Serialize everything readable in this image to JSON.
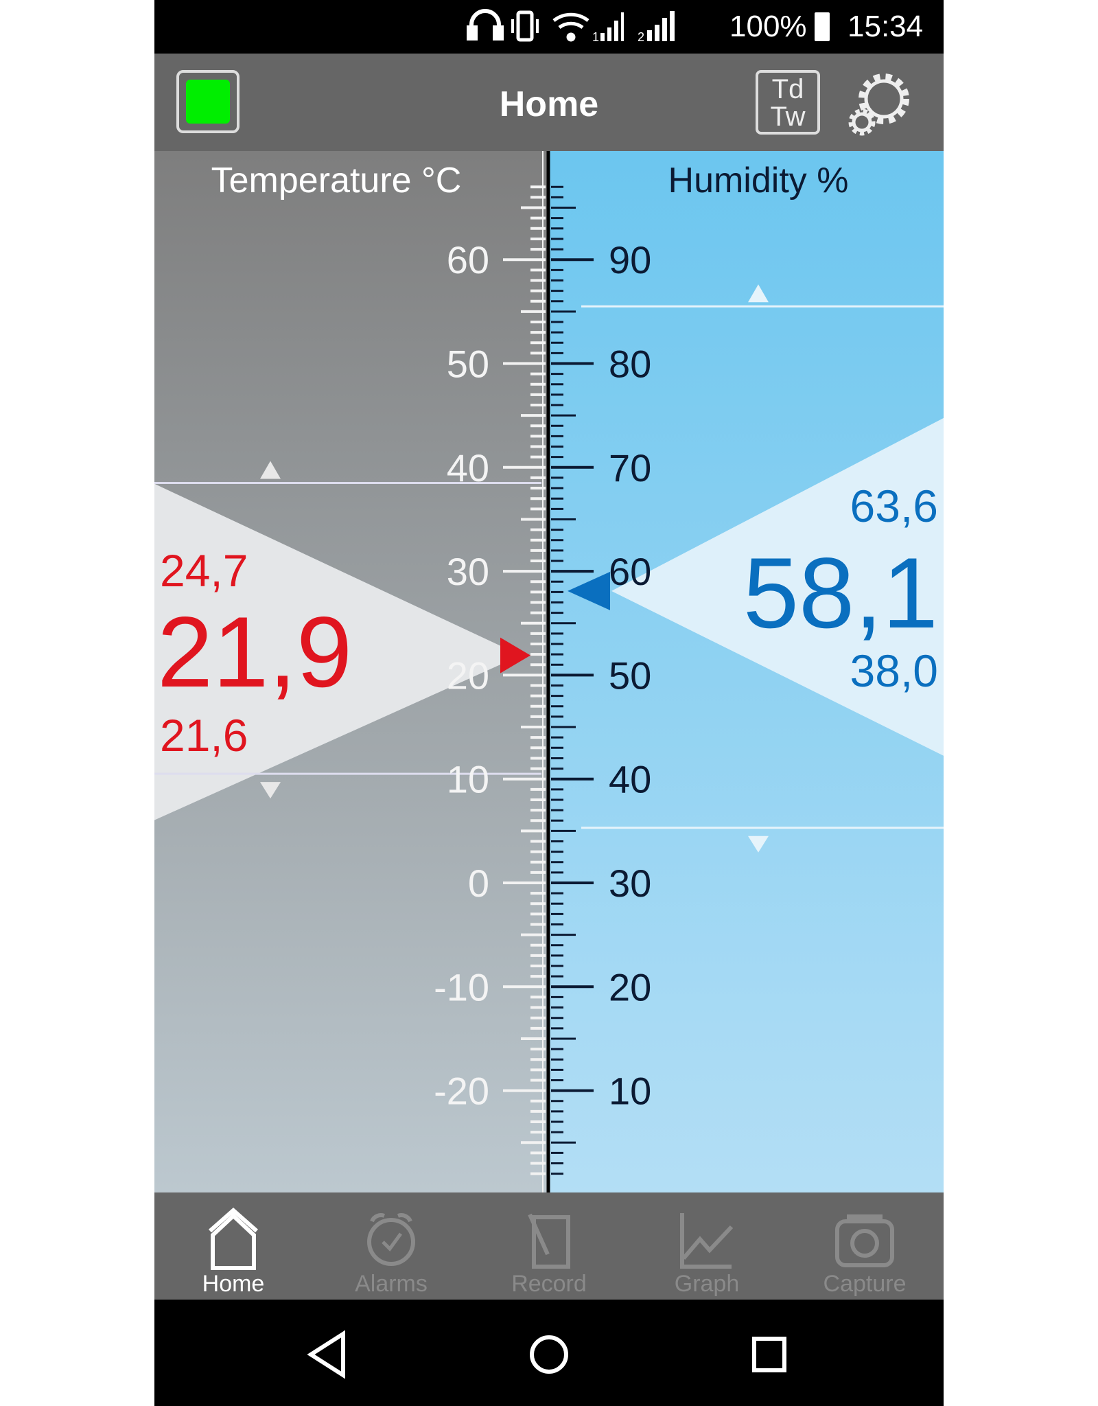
{
  "status_bar": {
    "battery": "100%",
    "time": "15:34",
    "sim1": "1",
    "sim2": "2",
    "icons": [
      "headset-icon",
      "vibrate-icon",
      "wifi-icon",
      "signal-icon",
      "signal-icon",
      "battery-icon"
    ]
  },
  "header": {
    "title": "Home",
    "status_color": "#00ee00",
    "td_tw_label_1": "Td",
    "td_tw_label_2": "Tw",
    "icons": [
      "status-indicator-icon",
      "td-tw-icon",
      "gear-icon"
    ]
  },
  "temperature": {
    "title": "Temperature °C",
    "value": "21,9",
    "max": "24,7",
    "min": "21,6",
    "value_num": 21.9,
    "max_num": 24.7,
    "min_num": 21.6,
    "alarm_high": 38.5,
    "alarm_low": 10.5,
    "ticks": [
      "60",
      "50",
      "40",
      "30",
      "20",
      "10",
      "0",
      "-10",
      "-20"
    ],
    "color": "#e0151f"
  },
  "humidity": {
    "title": "Humidity %",
    "value": "58,1",
    "max": "63,6",
    "min": "38,0",
    "value_num": 58.1,
    "alarm_high": 85.5,
    "alarm_low": 35.3,
    "ticks": [
      "90",
      "80",
      "70",
      "60",
      "50",
      "40",
      "30",
      "20",
      "10"
    ],
    "color": "#0a6fbf"
  },
  "bottom_nav": [
    {
      "label": "Home",
      "icon": "home-icon",
      "active": true
    },
    {
      "label": "Alarms",
      "icon": "alarm-clock-icon"
    },
    {
      "label": "Record",
      "icon": "record-icon"
    },
    {
      "label": "Graph",
      "icon": "graph-icon"
    },
    {
      "label": "Capture",
      "icon": "camera-icon"
    }
  ],
  "system_nav": [
    "back-icon",
    "home-circle-icon",
    "recents-icon"
  ]
}
